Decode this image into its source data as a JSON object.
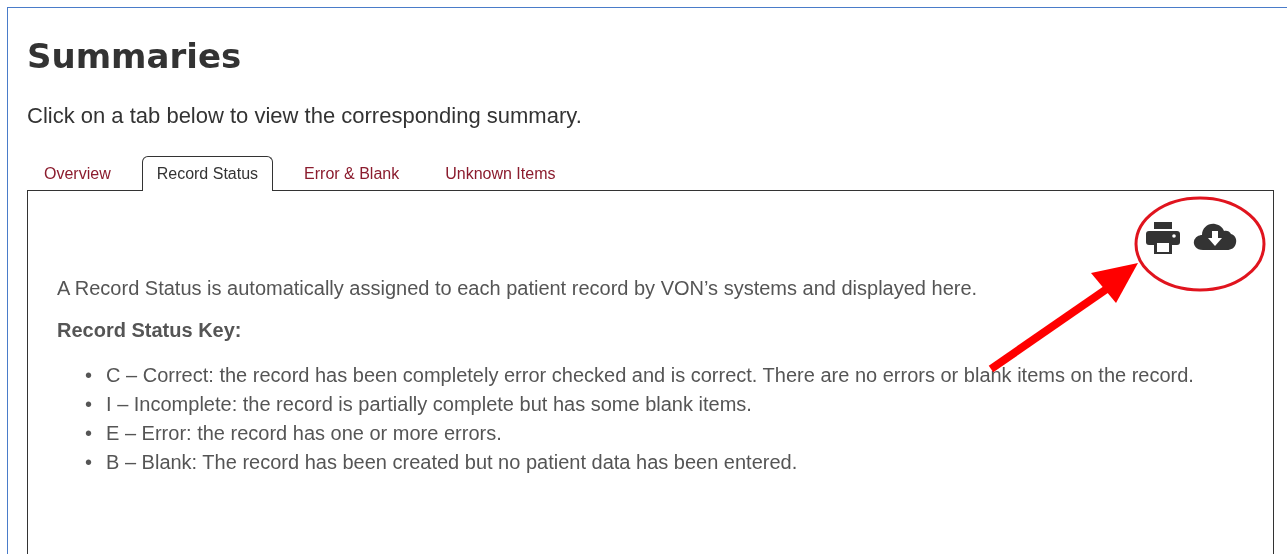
{
  "page": {
    "title": "Summaries",
    "instructions": "Click on a tab below to view the corresponding summary."
  },
  "tabs": [
    {
      "label": "Overview",
      "selected": false
    },
    {
      "label": "Record Status",
      "selected": true
    },
    {
      "label": "Error & Blank",
      "selected": false
    },
    {
      "label": "Unknown Items",
      "selected": false
    }
  ],
  "panel": {
    "intro": "A Record Status is automatically  assigned to each patient record by VON’s systems and displayed here.",
    "key_heading": "Record Status Key:",
    "bullet": "•",
    "key_items": [
      "C – Correct: the record has been completely error checked and is correct. There are no errors or blank items on the record.",
      "I – Incomplete: the record is partially complete but has some blank items.",
      "E – Error: the record has one or more errors.",
      "B – Blank: The record has been created but no patient data has been entered."
    ]
  }
}
